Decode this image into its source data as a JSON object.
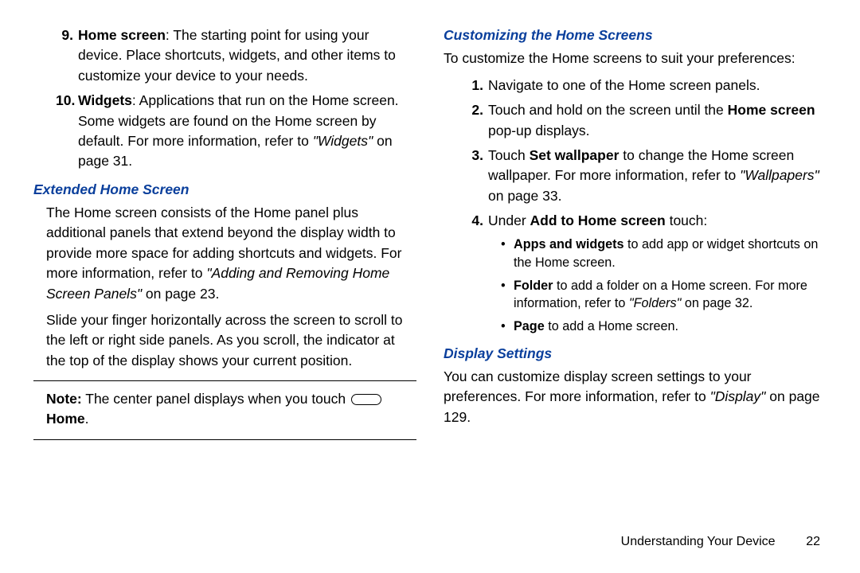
{
  "left": {
    "item9": {
      "n": "9.",
      "label": "Home screen",
      "text": ": The starting point for using your device. Place shortcuts, widgets, and other items to customize your device to your needs."
    },
    "item10": {
      "n": "10.",
      "label": "Widgets",
      "text_a": ": Applications that run on the Home screen. Some widgets are found on the Home screen by default. For more information, refer to ",
      "ref": "\"Widgets\"",
      "text_b": " on page 31."
    },
    "ext_h": "Extended Home Screen",
    "ext_p1a": "The Home screen consists of the Home panel plus additional panels that extend beyond the display width to provide more space for adding shortcuts and widgets. For more information, refer to ",
    "ext_p1ref": "\"Adding and Removing Home Screen Panels\"",
    "ext_p1b": " on page 23.",
    "ext_p2": "Slide your finger horizontally across the screen to scroll to the left or right side panels. As you scroll, the indicator at the top of the display shows your current position.",
    "note_a": "Note:",
    "note_b": " The center panel displays when you touch ",
    "note_c": "Home",
    "note_d": "."
  },
  "right": {
    "cust_h": "Customizing the Home Screens",
    "cust_p": "To customize the Home screens to suit your preferences:",
    "s1": {
      "n": "1.",
      "t": "Navigate to one of the Home screen panels."
    },
    "s2": {
      "n": "2.",
      "a": "Touch and hold on the screen until the ",
      "b": "Home screen",
      "c": " pop-up displays."
    },
    "s3": {
      "n": "3.",
      "a": "Touch ",
      "b": "Set wallpaper",
      "c": " to change the Home screen wallpaper. For more information, refer to ",
      "ref": "\"Wallpapers\"",
      "d": " on page 33."
    },
    "s4": {
      "n": "4.",
      "a": "Under ",
      "b": "Add to Home screen",
      "c": " touch:"
    },
    "b1": {
      "a": "Apps and widgets",
      "b": " to add app or widget shortcuts on the Home screen."
    },
    "b2": {
      "a": "Folder",
      "b": " to add a folder on a Home screen. For more information, refer to ",
      "ref": "\"Folders\"",
      "c": " on page 32."
    },
    "b3": {
      "a": "Page",
      "b": " to add a Home screen."
    },
    "disp_h": "Display Settings",
    "disp_a": "You can customize display screen settings to your preferences. For more information, refer to ",
    "disp_ref": "\"Display\"",
    "disp_b": " on page 129."
  },
  "footer": {
    "section": "Understanding Your Device",
    "page": "22"
  }
}
